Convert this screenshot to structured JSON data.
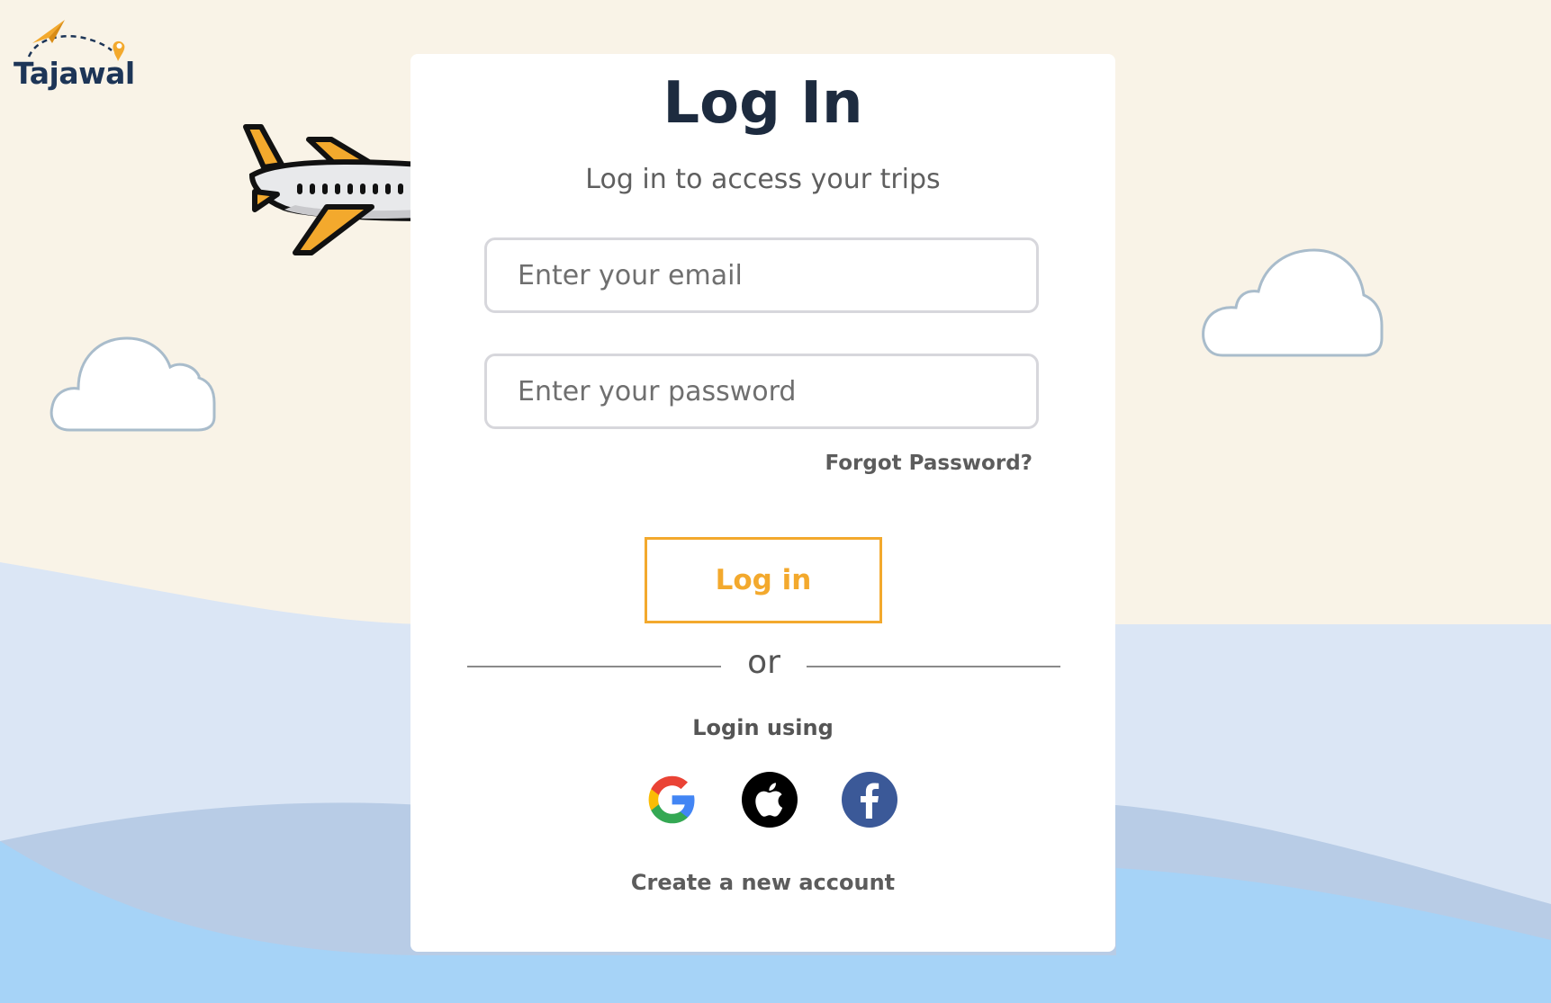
{
  "brand": {
    "name": "Tajawal"
  },
  "colors": {
    "accent": "#f3a92d",
    "title": "#1d2b3f",
    "background": "#f9f3e7",
    "wave_light": "#dbe6f5",
    "wave_mid": "#b8cce6",
    "wave_front": "#a6d3f7"
  },
  "login": {
    "title": "Log In",
    "subtitle": "Log in to access your trips",
    "email_placeholder": "Enter your email",
    "password_placeholder": "Enter your password",
    "forgot_label": "Forgot Password?",
    "submit_label": "Log in",
    "divider_text": "or",
    "social_prompt": "Login using",
    "social_icons": [
      "google-icon",
      "apple-icon",
      "facebook-icon"
    ],
    "create_account_label": "Create a new account"
  }
}
